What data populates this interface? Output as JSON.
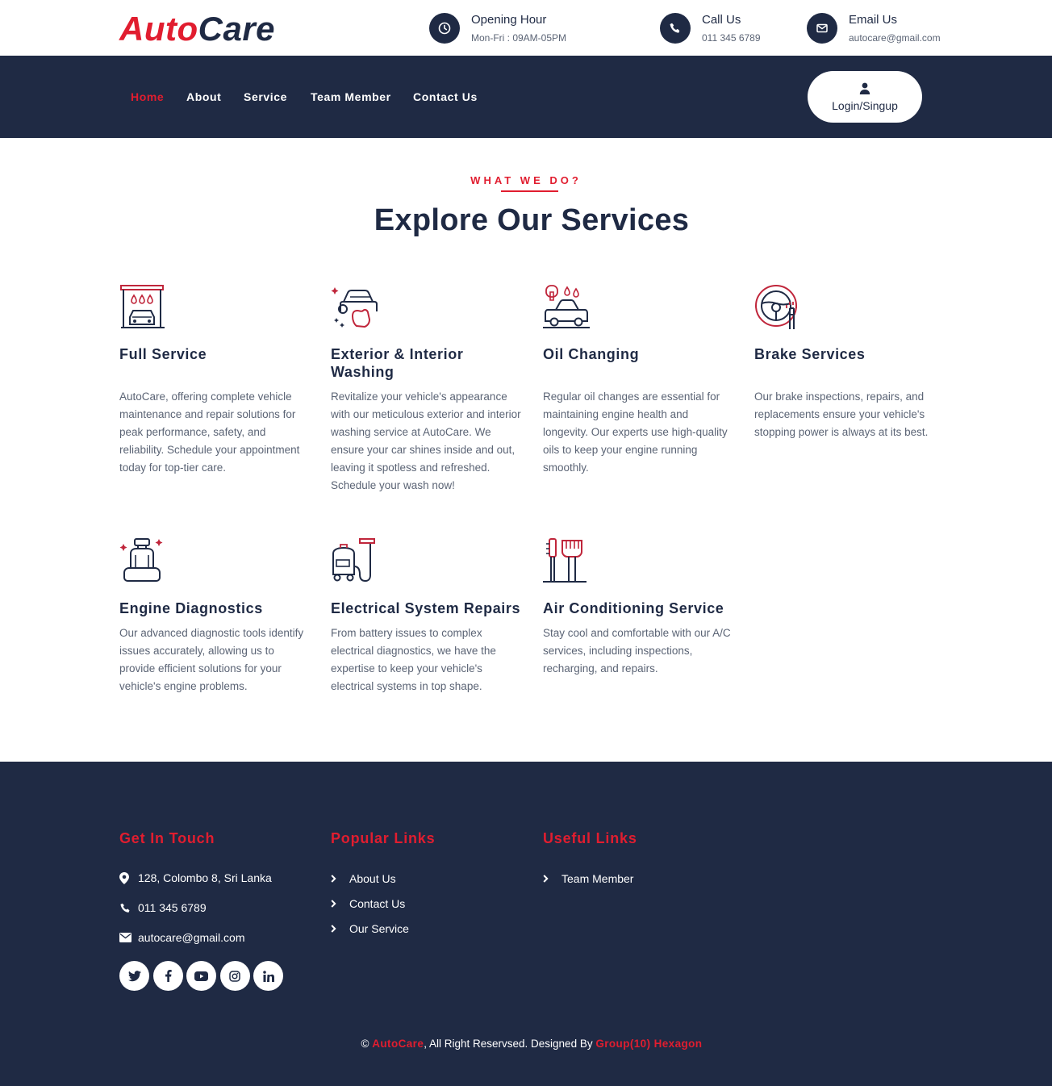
{
  "brand": {
    "part1": "Auto",
    "part2": "Care"
  },
  "topbar": {
    "hours": {
      "label": "Opening Hour",
      "value": "Mon-Fri : 09AM-05PM",
      "icon": "clock-icon"
    },
    "call": {
      "label": "Call Us",
      "value": "011 345 6789",
      "icon": "phone-icon"
    },
    "email": {
      "label": "Email Us",
      "value": "autocare@gmail.com",
      "icon": "envelope-icon"
    }
  },
  "nav": {
    "items": [
      {
        "label": "Home",
        "active": true
      },
      {
        "label": "About"
      },
      {
        "label": "Service"
      },
      {
        "label": "Team Member"
      },
      {
        "label": "Contact Us"
      }
    ],
    "login_label": "Login/Singup"
  },
  "section": {
    "kicker": "WHAT WE DO?",
    "title": "Explore Our Services"
  },
  "services": [
    {
      "title": "Full Service",
      "icon": "car-wash-icon",
      "text": "AutoCare, offering complete vehicle maintenance and repair solutions for peak performance, safety, and reliability. Schedule your appointment today for top-tier care."
    },
    {
      "title": "Exterior & Interior Washing",
      "icon": "car-cleaning-icon",
      "text": "Revitalize your vehicle's appearance with our meticulous exterior and interior washing service at AutoCare. We ensure your car shines inside and out, leaving it spotless and refreshed. Schedule your wash now!"
    },
    {
      "title": "Oil Changing",
      "icon": "oil-change-icon",
      "text": "Regular oil changes are essential for maintaining engine health and longevity. Our experts use high-quality oils to keep your engine running smoothly."
    },
    {
      "title": "Brake Services",
      "icon": "steering-wheel-icon",
      "text": "Our brake inspections, repairs, and replacements ensure your vehicle's stopping power is always at its best."
    },
    {
      "title": "Engine Diagnostics",
      "icon": "car-seat-icon",
      "text": "Our advanced diagnostic tools identify issues accurately, allowing us to provide efficient solutions for your vehicle's engine problems."
    },
    {
      "title": "Electrical System Repairs",
      "icon": "vacuum-cleaner-icon",
      "text": "From battery issues to complex electrical diagnostics, we have the expertise to keep your vehicle's electrical systems in top shape."
    },
    {
      "title": "Air Conditioning Service",
      "icon": "brushes-icon",
      "text": "Stay cool and comfortable with our A/C services, including inspections, recharging, and repairs."
    }
  ],
  "footer": {
    "get_in_touch": {
      "heading": "Get In Touch",
      "address": "128, Colombo 8, Sri Lanka",
      "phone": "011 345 6789",
      "email": "autocare@gmail.com"
    },
    "popular_links": {
      "heading": "Popular Links",
      "items": [
        "About Us",
        "Contact Us",
        "Our Service"
      ]
    },
    "useful_links": {
      "heading": "Useful Links",
      "items": [
        "Team Member"
      ]
    },
    "socials": [
      "twitter-icon",
      "facebook-icon",
      "youtube-icon",
      "instagram-icon",
      "linkedin-icon"
    ],
    "copyright": {
      "symbol": "©",
      "brand": "AutoCare",
      "middle": ", All Right Reservsed. Designed By",
      "designer": "Group(10) Hexagon"
    }
  },
  "colors": {
    "navy": "#1f2a44",
    "red": "#e11d2f",
    "text_gray": "#5b6475"
  }
}
